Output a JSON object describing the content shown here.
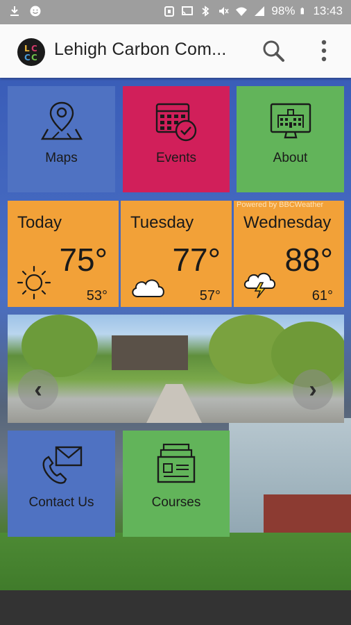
{
  "status_bar": {
    "battery": "98%",
    "time": "13:43"
  },
  "app_bar": {
    "title": "Lehigh Carbon Com...",
    "logo_text": "LCCC",
    "search_icon": "search-icon",
    "menu_icon": "more-vert-icon"
  },
  "tiles": {
    "maps": {
      "label": "Maps",
      "icon": "map-pin-icon",
      "color": "#4f72c2"
    },
    "events": {
      "label": "Events",
      "icon": "calendar-check-icon",
      "color": "#d11f5a"
    },
    "about": {
      "label": "About",
      "icon": "building-monitor-icon",
      "color": "#62b45a"
    },
    "contact": {
      "label": "Contact Us",
      "icon": "envelope-phone-icon",
      "color": "#4f72c2"
    },
    "courses": {
      "label": "Courses",
      "icon": "course-cards-icon",
      "color": "#62b45a"
    }
  },
  "weather": {
    "powered_by": "Powered by BBCWeather",
    "color": "#f2a138",
    "days": [
      {
        "day": "Today",
        "high": "75°",
        "low": "53°",
        "icon": "sun-icon"
      },
      {
        "day": "Tuesday",
        "high": "77°",
        "low": "57°",
        "icon": "cloud-icon"
      },
      {
        "day": "Wednesday",
        "high": "88°",
        "low": "61°",
        "icon": "thunderstorm-icon"
      }
    ]
  },
  "carousel": {
    "prev_label": "‹",
    "next_label": "›"
  }
}
